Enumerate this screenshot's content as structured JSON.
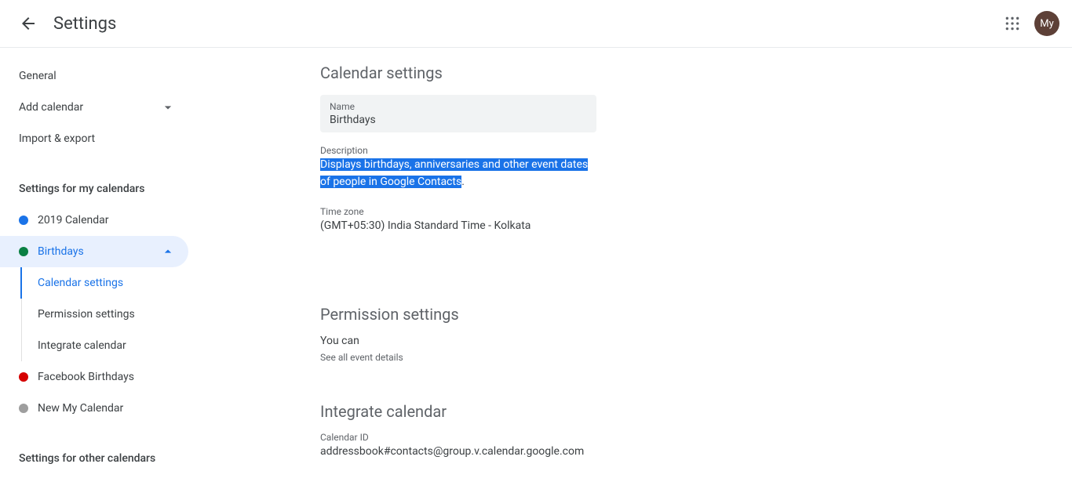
{
  "header": {
    "title": "Settings",
    "avatar_text": "My"
  },
  "sidebar": {
    "general": "General",
    "add_calendar": "Add calendar",
    "import_export": "Import & export",
    "my_calendars_title": "Settings for my calendars",
    "other_calendars_title": "Settings for other calendars",
    "calendars": [
      {
        "label": "2019 Calendar",
        "color": "#1a73e8"
      },
      {
        "label": "Birthdays",
        "color": "#0b8043"
      },
      {
        "label": "Facebook Birthdays",
        "color": "#d50000"
      },
      {
        "label": "New My Calendar",
        "color": "#9e9e9e"
      }
    ],
    "sub_items": {
      "calendar_settings": "Calendar settings",
      "permission_settings": "Permission settings",
      "integrate_calendar": "Integrate calendar"
    }
  },
  "content": {
    "calendar_settings": {
      "title": "Calendar settings",
      "name_label": "Name",
      "name_value": "Birthdays",
      "description_label": "Description",
      "description_value_line1": "Displays birthdays, anniversaries and other event dates",
      "description_value_line2": "of people in Google Contacts",
      "timezone_label": "Time zone",
      "timezone_value": "(GMT+05:30) India Standard Time - Kolkata"
    },
    "permission_settings": {
      "title": "Permission settings",
      "you_can": "You can",
      "detail": "See all event details"
    },
    "integrate_calendar": {
      "title": "Integrate calendar",
      "id_label": "Calendar ID",
      "id_value": "addressbook#contacts@group.v.calendar.google.com"
    }
  }
}
